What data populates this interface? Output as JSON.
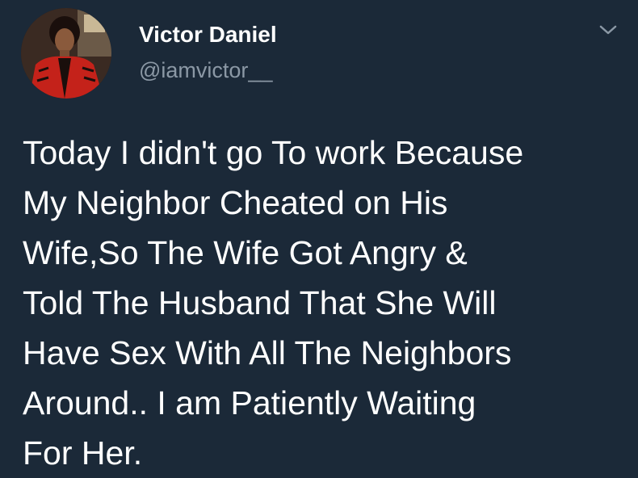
{
  "user": {
    "display_name": "Victor Daniel",
    "handle": "@iamvictor__",
    "avatar_icon": "profile-photo-avatar"
  },
  "menu": {
    "icon": "chevron-down-icon"
  },
  "tweet": {
    "lines": [
      "Today I didn't go To work Because",
      "My Neighbor Cheated on His",
      "Wife,So The Wife Got Angry &",
      "Told The Husband That She Will",
      "Have Sex With All The Neighbors",
      "Around.. I am Patiently Waiting",
      "For Her."
    ]
  },
  "colors": {
    "background": "#1b2938",
    "primary_text": "#ffffff",
    "secondary_text": "#8b98a5"
  }
}
